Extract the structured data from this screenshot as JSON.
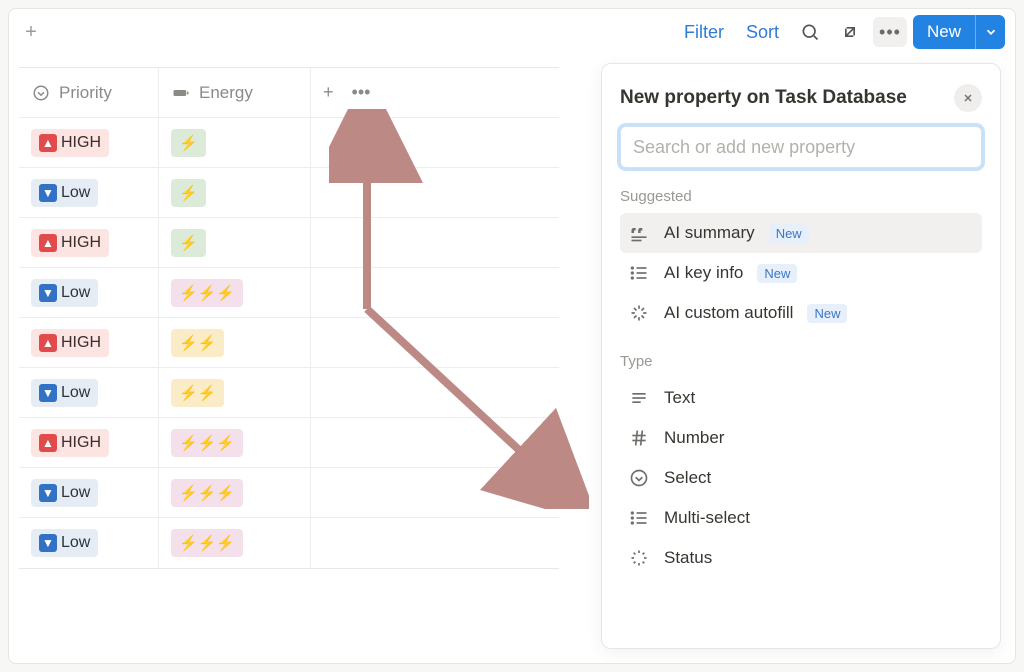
{
  "toolbar": {
    "filter": "Filter",
    "sort": "Sort",
    "new_label": "New"
  },
  "columns": {
    "priority": "Priority",
    "energy": "Energy"
  },
  "rows": [
    {
      "priority": "HIGH",
      "priority_kind": "high",
      "energy": "⚡",
      "energy_kind": "green"
    },
    {
      "priority": "Low",
      "priority_kind": "low",
      "energy": "⚡",
      "energy_kind": "green"
    },
    {
      "priority": "HIGH",
      "priority_kind": "high",
      "energy": "⚡",
      "energy_kind": "green"
    },
    {
      "priority": "Low",
      "priority_kind": "low",
      "energy": "⚡⚡⚡",
      "energy_kind": "pink"
    },
    {
      "priority": "HIGH",
      "priority_kind": "high",
      "energy": "⚡⚡",
      "energy_kind": "yellow"
    },
    {
      "priority": "Low",
      "priority_kind": "low",
      "energy": "⚡⚡",
      "energy_kind": "yellow"
    },
    {
      "priority": "HIGH",
      "priority_kind": "high",
      "energy": "⚡⚡⚡",
      "energy_kind": "pink"
    },
    {
      "priority": "Low",
      "priority_kind": "low",
      "energy": "⚡⚡⚡",
      "energy_kind": "pink"
    },
    {
      "priority": "Low",
      "priority_kind": "low",
      "energy": "⚡⚡⚡",
      "energy_kind": "pink"
    }
  ],
  "panel": {
    "title": "New property on Task Database",
    "search_placeholder": "Search or add new property",
    "suggested_label": "Suggested",
    "type_label": "Type",
    "new_badge": "New",
    "suggested": [
      {
        "label": "AI summary",
        "icon": "quote-icon",
        "new": true
      },
      {
        "label": "AI key info",
        "icon": "list-icon",
        "new": true
      },
      {
        "label": "AI custom autofill",
        "icon": "sparkle-icon",
        "new": true
      }
    ],
    "types": [
      {
        "label": "Text",
        "icon": "text-icon"
      },
      {
        "label": "Number",
        "icon": "hash-icon"
      },
      {
        "label": "Select",
        "icon": "select-icon"
      },
      {
        "label": "Multi-select",
        "icon": "list-icon"
      },
      {
        "label": "Status",
        "icon": "status-icon"
      }
    ]
  }
}
